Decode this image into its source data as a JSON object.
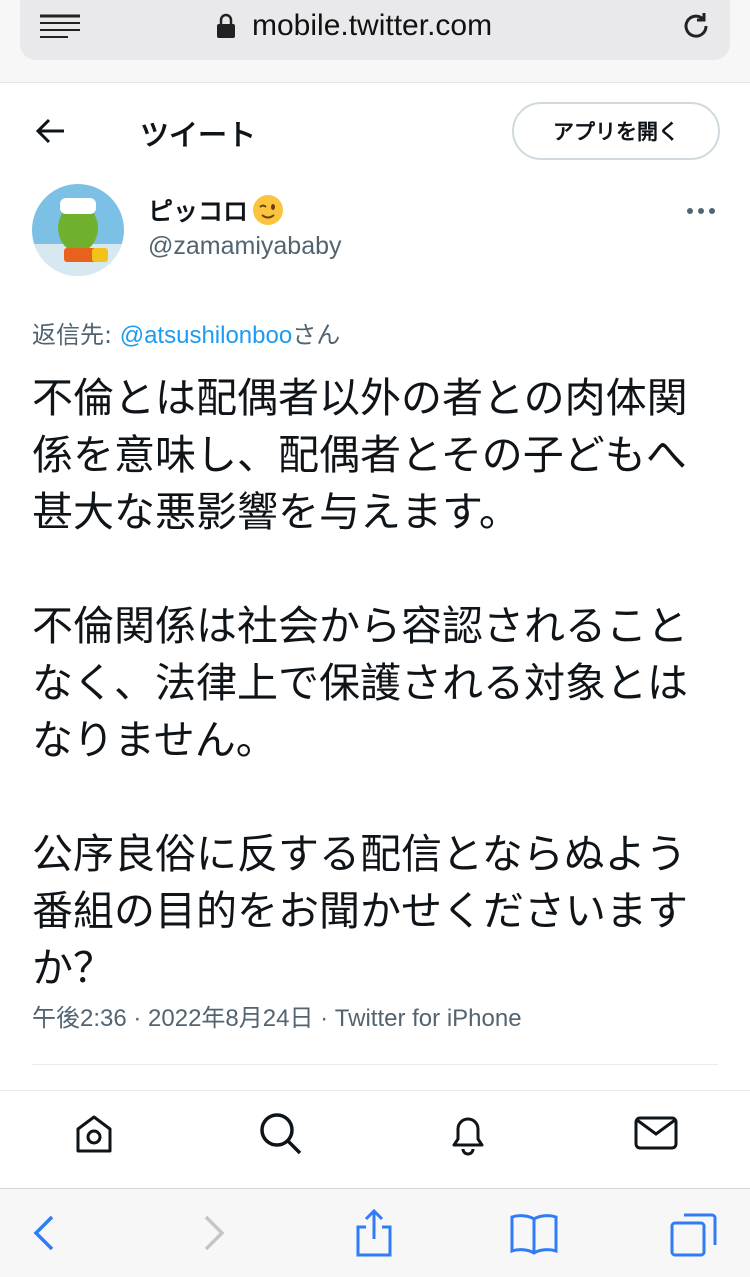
{
  "browser": {
    "url": "mobile.twitter.com",
    "icons": [
      "menu-icon",
      "lock-icon",
      "reload-icon"
    ]
  },
  "header": {
    "title": "ツイート",
    "open_app_label": "アプリを開く"
  },
  "tweet": {
    "display_name": "ピッコロ",
    "handle": "@zamamiyababy",
    "reply_prefix": "返信先: ",
    "reply_mention": "@atsushilonboo",
    "reply_suffix": "さん",
    "paragraphs": [
      "不倫とは配偶者以外の者との肉体関係を意味し、配偶者とその子どもへ甚大な悪影響を与えます。",
      "不倫関係は社会から容認されることなく、法律上で保護される対象とはなりません。",
      "公序良俗に反する配信とならぬよう番組の目的をお聞かせくださいますか？"
    ],
    "meta": "午後2:36 · 2022年8月24日 · Twitter for iPhone"
  },
  "colors": {
    "accent": "#1d9bf0",
    "text": "#0f1419",
    "secondary": "#536471",
    "safari_blue": "#2f7cf6"
  }
}
